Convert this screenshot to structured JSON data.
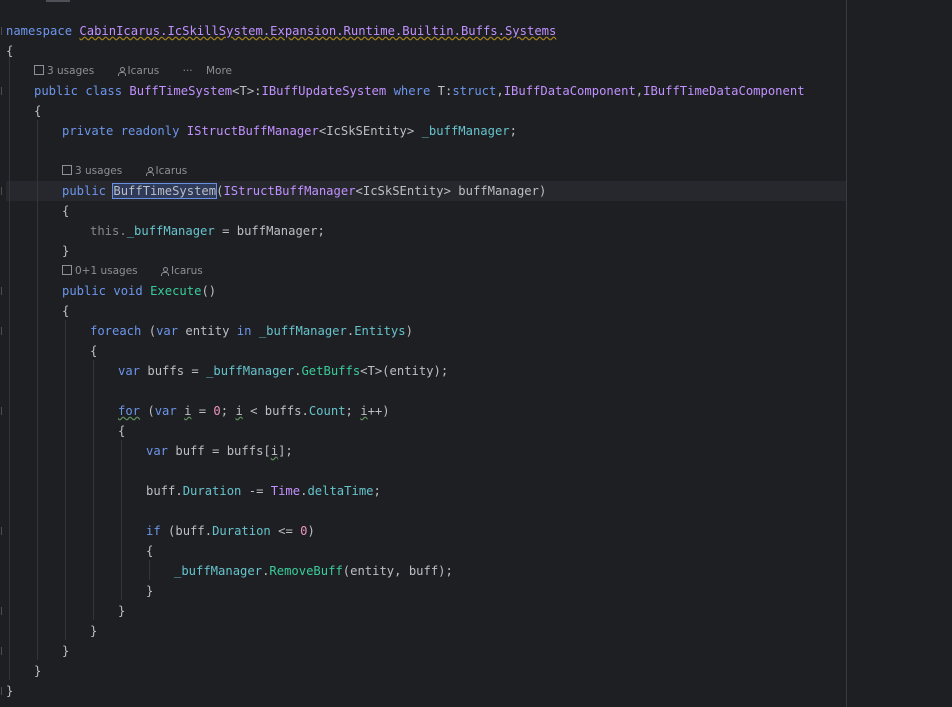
{
  "code": {
    "namespace_kw": "namespace",
    "namespace_name": "CabinIcarus.IcSkillSystem.Expansion.Runtime.Builtin.Buffs.Systems",
    "open_brace": "{",
    "close_brace": "}",
    "class_hint": {
      "usages": "3 usages",
      "author": "Icarus",
      "more": "More"
    },
    "class_decl": {
      "public": "public",
      "class": "class",
      "name": "BuffTimeSystem",
      "generic": "<T>:",
      "base": "IBuffUpdateSystem",
      "where": "where",
      "constraint": "T:",
      "struct": "struct",
      "c1": ",",
      "iface1": "IBuffDataComponent",
      "c2": ",",
      "iface2": "IBuffTimeDataComponent"
    },
    "field_decl": {
      "private": "private",
      "readonly": "readonly",
      "type": "IStructBuffManager",
      "lt": "<",
      "targ": "IcSkSEntity",
      "gt": ">",
      "name": "_buffManager",
      "semi": ";"
    },
    "ctor_hint": {
      "usages": "3 usages",
      "author": "Icarus"
    },
    "ctor_decl": {
      "public": "public",
      "name": "BuffTimeSystem",
      "lp": "(",
      "ptype": "IStructBuffManager",
      "lt": "<",
      "targ": "IcSkSEntity",
      "gt": ">",
      "pname": " buffManager)"
    },
    "ctor_body": {
      "this": "this.",
      "field": "_buffManager",
      "rest": " = buffManager;"
    },
    "exec_hint": {
      "usages": "0+1 usages",
      "author": "Icarus"
    },
    "exec_decl": {
      "public": "public",
      "void": "void",
      "name": "Execute",
      "parens": "()"
    },
    "foreach_line": {
      "kw": "foreach",
      "lp": " (",
      "var": "var",
      "entity": " entity ",
      "in": "in",
      "field": "_buffManager",
      "dot": ".",
      "prop": "Entitys",
      "rp": ")"
    },
    "var_buffs": {
      "var": "var",
      "lhs": " buffs = ",
      "field": "_buffManager",
      "dot": ".",
      "method": "GetBuffs",
      "rest": "<T>(entity);"
    },
    "for_line": {
      "kw": "for",
      "lp": " (",
      "var": "var",
      "i1": "i",
      "eq": " = ",
      "zero": "0",
      "semi1": "; ",
      "i2": "i",
      "lt": " < buffs.",
      "count": "Count",
      "semi2": "; ",
      "i3": "i",
      "inc": "++)"
    },
    "var_buff": {
      "var": "var",
      "rest": " buff = buffs[",
      "i": "i",
      "end": "];"
    },
    "duration_line": {
      "buff": "buff.",
      "duration": "Duration",
      "op": " -= ",
      "time": "Time",
      "dot": ".",
      "dt": "deltaTime",
      "semi": ";"
    },
    "if_line": {
      "kw": "if",
      "lp": " (buff.",
      "duration": "Duration",
      "op": " <= ",
      "zero": "0",
      "rp": ")"
    },
    "remove_line": {
      "field": "_buffManager",
      "dot": ".",
      "method": "RemoveBuff",
      "rest": "(entity, buff);"
    }
  }
}
